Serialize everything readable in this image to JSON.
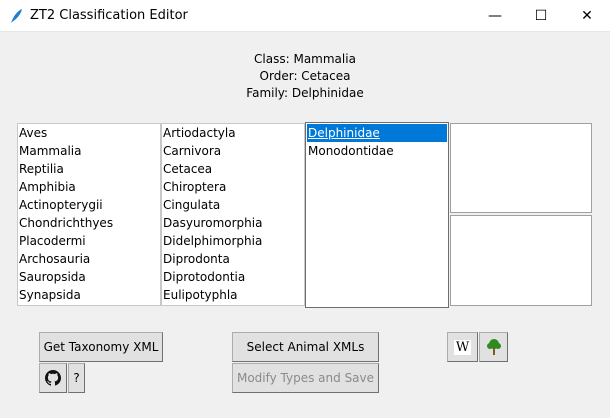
{
  "window": {
    "title": "ZT2 Classification Editor",
    "minimize": "—",
    "maximize": "☐",
    "close": "✕"
  },
  "info": {
    "class_line": "Class: Mammalia",
    "order_line": "Order: Cetacea",
    "family_line": "Family: Delphinidae"
  },
  "lists": {
    "classes": [
      "Aves",
      "Mammalia",
      "Reptilia",
      "Amphibia",
      "Actinopterygii",
      "Chondrichthyes",
      "Placodermi",
      "Archosauria",
      "Sauropsida",
      "Synapsida"
    ],
    "orders": [
      "Artiodactyla",
      "Carnivora",
      "Cetacea",
      "Chiroptera",
      "Cingulata",
      "Dasyuromorphia",
      "Didelphimorphia",
      "Diprodonta",
      "Diprotodontia",
      "Eulipotyphla"
    ],
    "families": [
      "Delphinidae",
      "Monodontidae"
    ],
    "selected_family": "Delphinidae"
  },
  "buttons": {
    "get_taxonomy": "Get Taxonomy XML",
    "help": "?",
    "select_animals": "Select Animal XMLs",
    "modify_save": "Modify Types and Save",
    "wiki": "W"
  },
  "colors": {
    "selection": "#0078d7",
    "tree": "#2e8b1e"
  }
}
